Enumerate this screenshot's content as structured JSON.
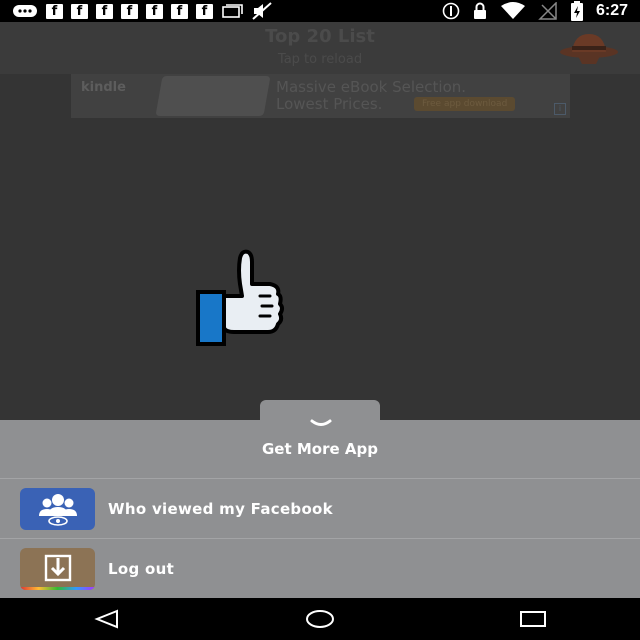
{
  "status_bar": {
    "time": "6:27",
    "left_icons": [
      "message-icon",
      "facebook-icon",
      "facebook-icon",
      "facebook-icon",
      "facebook-icon",
      "facebook-icon",
      "facebook-icon",
      "facebook-icon",
      "gallery-icon",
      "mute-icon"
    ],
    "right_icons": [
      "info-icon",
      "lock-icon",
      "wifi-icon",
      "no-signal-icon",
      "battery-charging-icon"
    ]
  },
  "header": {
    "title": "Top 20 List",
    "subtitle": "Tap to reload"
  },
  "ad": {
    "brand": "kindle",
    "line1": "Massive eBook Selection.",
    "line2": "Lowest Prices.",
    "button": "Free app download"
  },
  "sheet": {
    "title": "Get More App",
    "items": [
      {
        "label": "Who viewed my Facebook",
        "icon": "who-viewed-app-icon"
      },
      {
        "label": "Log out",
        "icon": "logout-icon"
      }
    ]
  },
  "colors": {
    "background": "#343434",
    "sheet": "#8f9092",
    "facebook_blue": "#1877c8",
    "app_icon_blue": "#3a62b5"
  }
}
